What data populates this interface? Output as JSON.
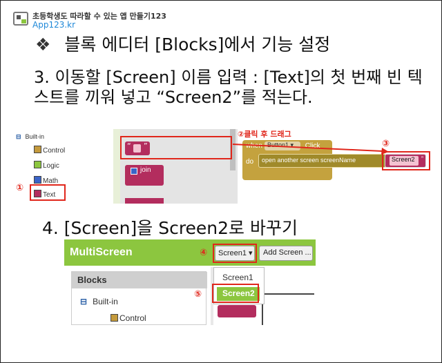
{
  "header": {
    "title": "초등학생도 따라할 수 있는 앱 만들기123",
    "subtitle": "App123.kr"
  },
  "heading": {
    "bullet": "❖",
    "text": "블록 에디터 [Blocks]에서 기능 설정"
  },
  "step3": {
    "text": "3. 이동할 [Screen] 이름 입력 : [Text]의 첫 번째 빈 텍스트를 끼워 넣고 “Screen2”를 적는다."
  },
  "screenshot1": {
    "tree_root": "Built-in",
    "tree_items": [
      "Control",
      "Logic",
      "Math",
      "Text"
    ],
    "swatch_colors": [
      "#c49a3c",
      "#8cc63f",
      "#3a64c8",
      "#b32d5e"
    ],
    "join_label": "join",
    "quote_left": "“",
    "quote_right": "”",
    "marker1": "①",
    "marker2": "②",
    "marker3": "③",
    "drag_label": "②클릭 후 드래그",
    "when": "when",
    "button_name": "Button1",
    "click": ".Click",
    "do": "do",
    "open_screen": "open another screen  screenName",
    "screen2_value": "Screen2"
  },
  "step4": {
    "text": "4. [Screen]을 Screen2로 바꾸기"
  },
  "screenshot2": {
    "app_name": "MultiScreen",
    "screen_select": "Screen1 ▾",
    "add_screen": "Add Screen ...",
    "panel_title": "Blocks",
    "built_in": "Built-in",
    "control": "Control",
    "dropdown_options": [
      "Screen1",
      "Screen2"
    ],
    "marker4": "④",
    "marker5": "⑤"
  },
  "colors": {
    "accent_green": "#8cc63f",
    "highlight_red": "#e0261b",
    "text_block": "#b32d5e",
    "event_block": "#c4a23e"
  }
}
